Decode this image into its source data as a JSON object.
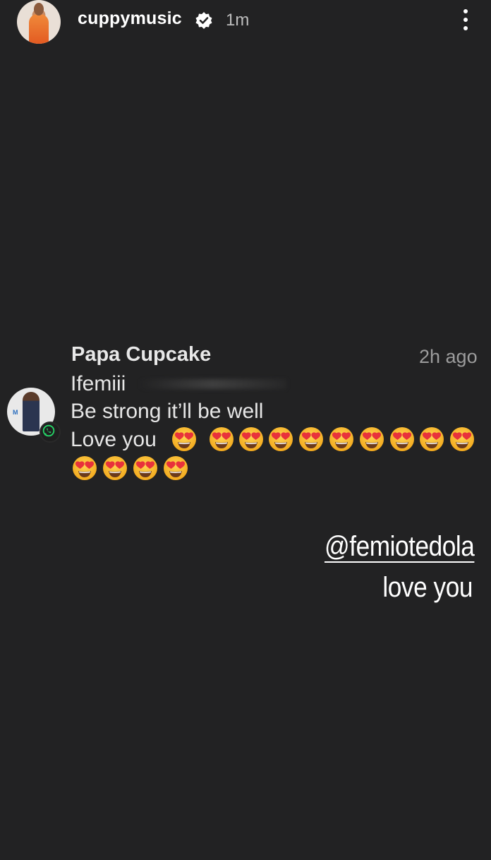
{
  "story": {
    "username": "cuppymusic",
    "timestamp": "1m",
    "verified": true,
    "menu_icon": "more-vertical-icon"
  },
  "notification": {
    "app_icon": "whatsapp-icon",
    "sender": "Papa Cupcake",
    "time": "2h ago",
    "lines": [
      "Ifemiii",
      "Be strong it’ll be well",
      "Love you"
    ],
    "emoji": "heart-eyes-emoji",
    "emoji_count": 13
  },
  "caption": {
    "mention": "@femiotedola",
    "text": "love you"
  },
  "colors": {
    "background": "#222223",
    "text_primary": "#ffffff",
    "text_secondary": "#9c9c9c",
    "whatsapp_green": "#25d366",
    "emoji_face": "#f7b52c",
    "emoji_heart": "#e8323b"
  }
}
